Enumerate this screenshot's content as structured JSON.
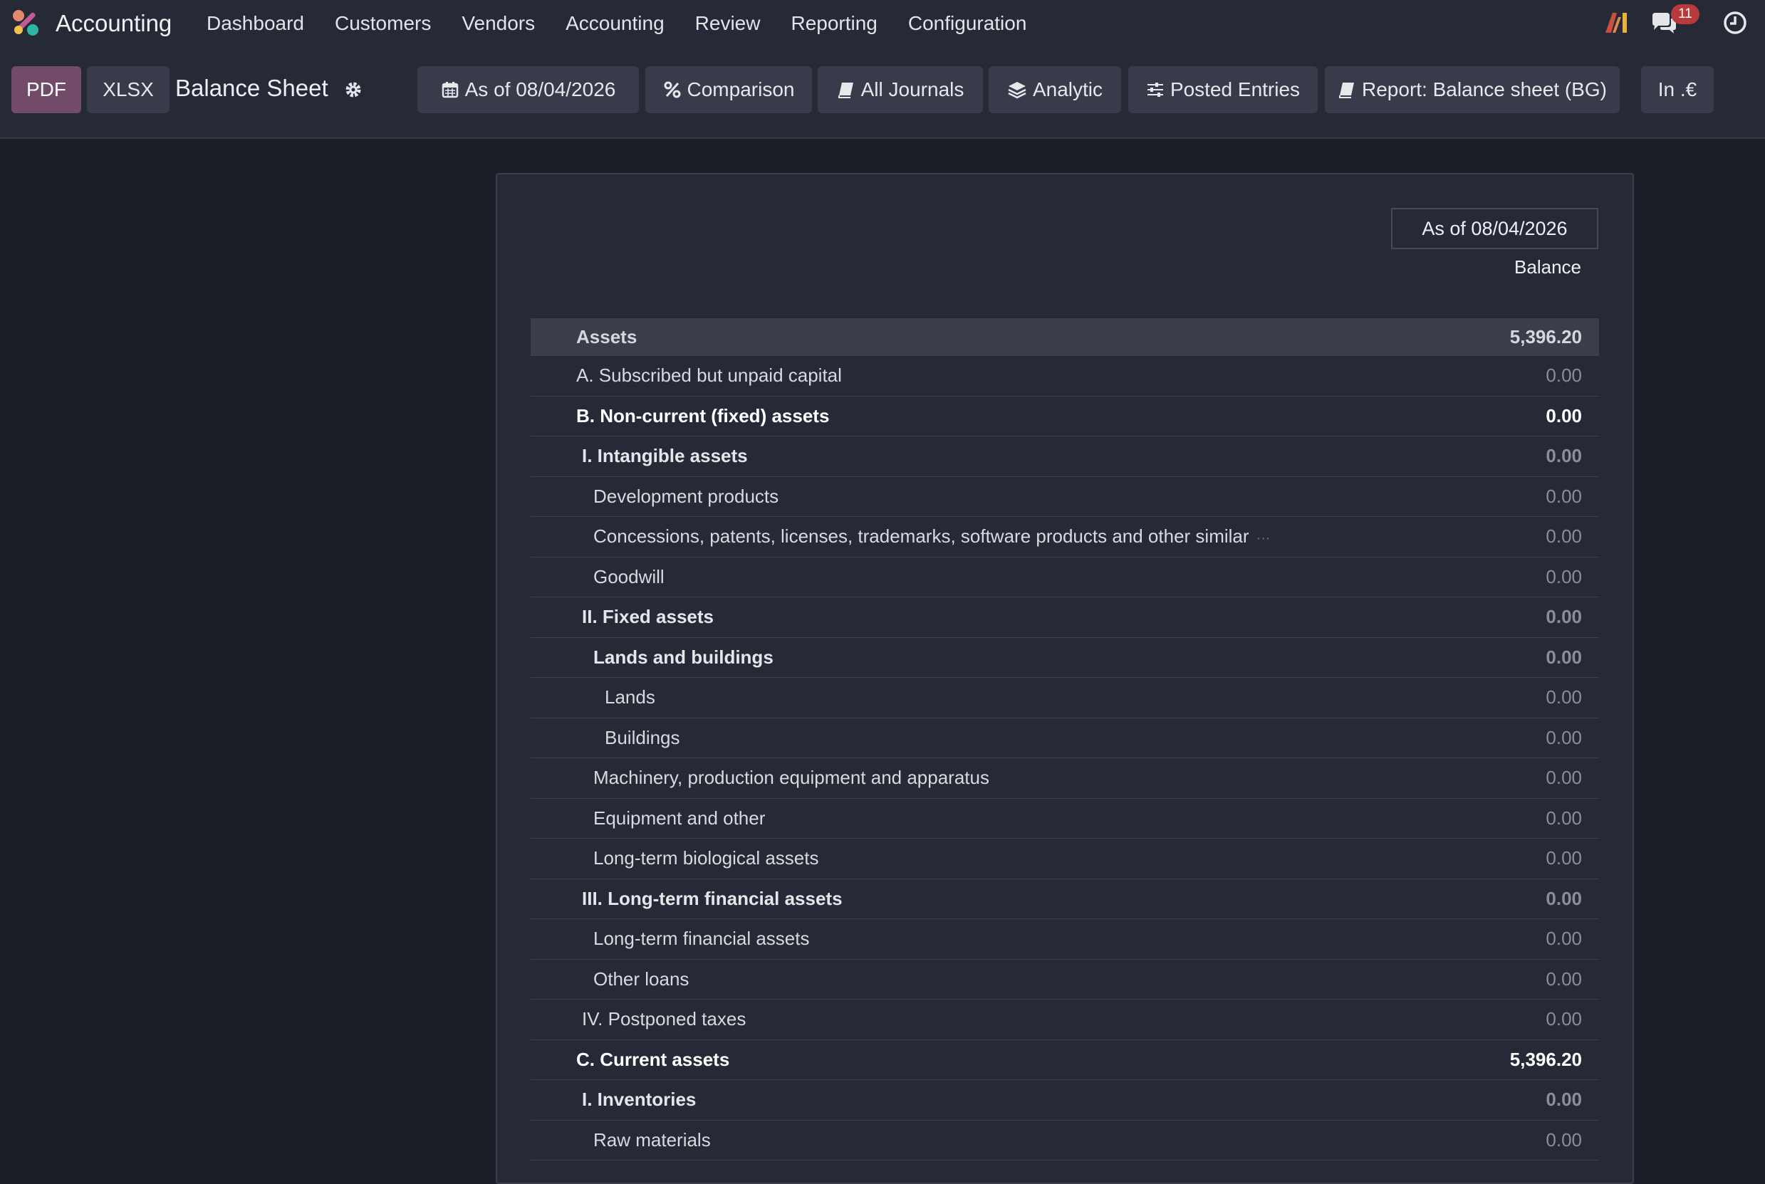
{
  "app": {
    "name": "Accounting"
  },
  "menu": [
    "Dashboard",
    "Customers",
    "Vendors",
    "Accounting",
    "Review",
    "Reporting",
    "Configuration"
  ],
  "notifications": {
    "badge_count": "11"
  },
  "toolbar": {
    "pdf_label": "PDF",
    "xlsx_label": "XLSX",
    "title": "Balance Sheet",
    "filters": {
      "date": "As of 08/04/2026",
      "comparison": "Comparison",
      "journals": "All Journals",
      "analytic": "Analytic",
      "entries": "Posted Entries",
      "report": "Report: Balance sheet (BG)",
      "currency": "In .€"
    }
  },
  "report": {
    "column_date": "As of 08/04/2026",
    "column_balance": "Balance",
    "rows": [
      {
        "label": "Assets",
        "amount": "5,396.20"
      },
      {
        "label": "A. Subscribed but unpaid capital",
        "amount": "0.00"
      },
      {
        "label": "B. Non-current (fixed) assets",
        "amount": "0.00"
      },
      {
        "label": "I. Intangible assets",
        "amount": "0.00"
      },
      {
        "label": "Development products",
        "amount": "0.00"
      },
      {
        "label": "Concessions, patents, licenses, trademarks, software products and other similar",
        "amount": "0.00",
        "ellipsis": "···"
      },
      {
        "label": "Goodwill",
        "amount": "0.00"
      },
      {
        "label": "II. Fixed assets",
        "amount": "0.00"
      },
      {
        "label": "Lands and buildings",
        "amount": "0.00"
      },
      {
        "label": "Lands",
        "amount": "0.00"
      },
      {
        "label": "Buildings",
        "amount": "0.00"
      },
      {
        "label": "Machinery, production equipment and apparatus",
        "amount": "0.00"
      },
      {
        "label": "Equipment and other",
        "amount": "0.00"
      },
      {
        "label": "Long-term biological assets",
        "amount": "0.00"
      },
      {
        "label": "III. Long-term financial assets",
        "amount": "0.00"
      },
      {
        "label": "Long-term financial assets",
        "amount": "0.00"
      },
      {
        "label": "Other loans",
        "amount": "0.00"
      },
      {
        "label": "IV. Postponed taxes",
        "amount": "0.00"
      },
      {
        "label": "C. Current assets",
        "amount": "5,396.20"
      },
      {
        "label": "I. Inventories",
        "amount": "0.00"
      },
      {
        "label": "Raw materials",
        "amount": "0.00"
      }
    ]
  }
}
